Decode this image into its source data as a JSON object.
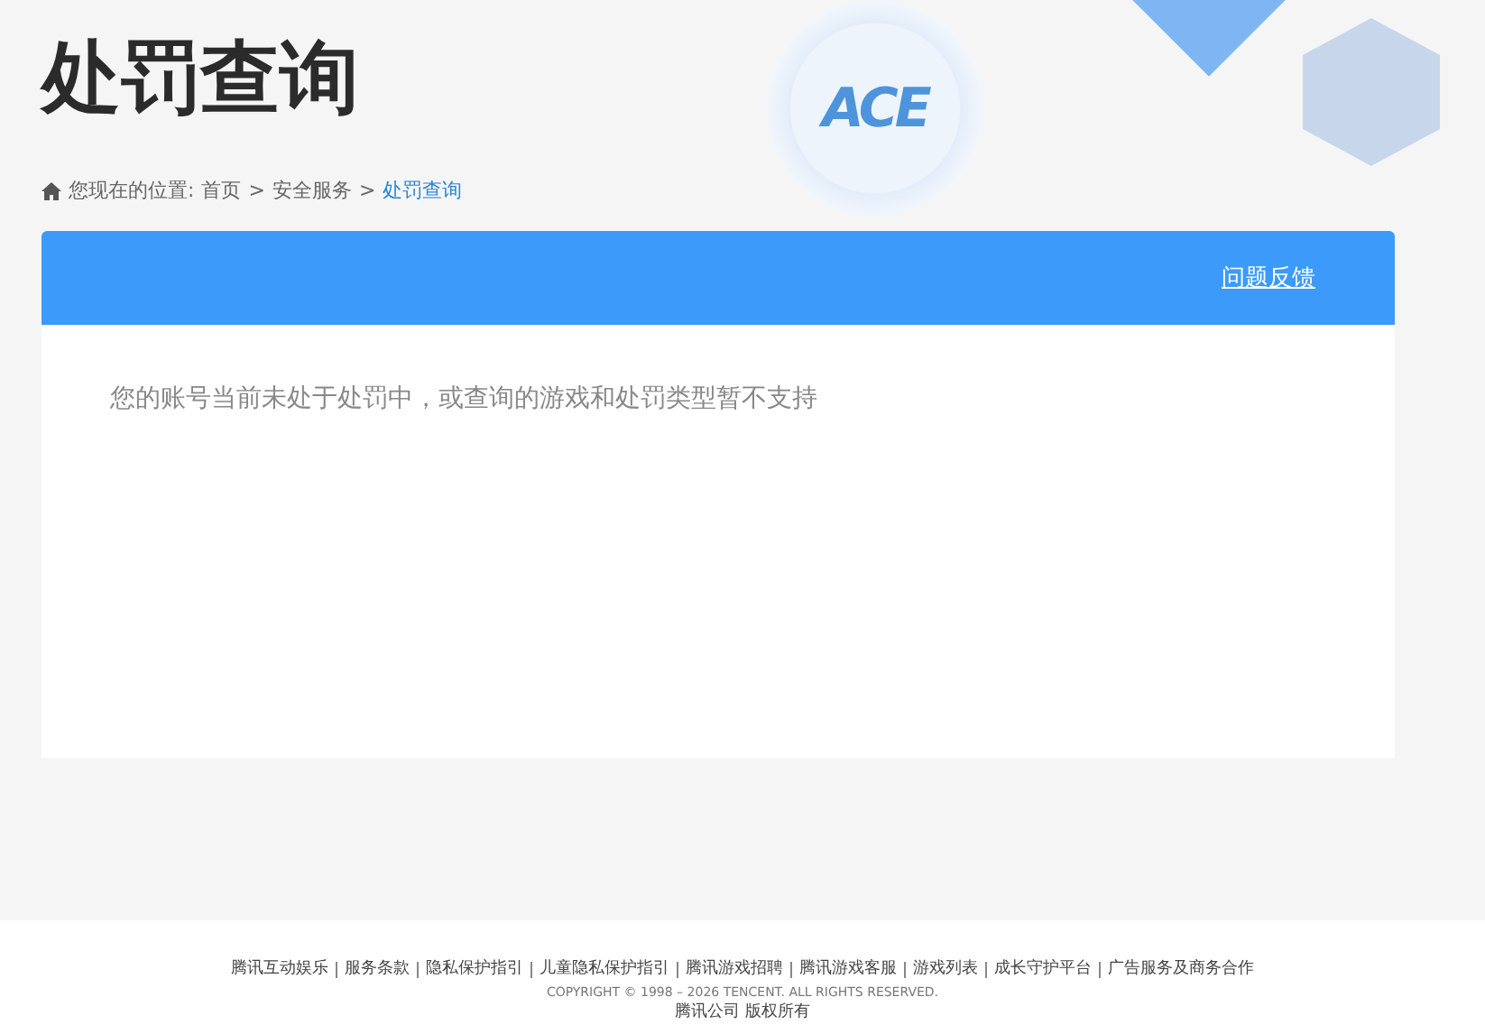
{
  "header": {
    "title": "处罚查询",
    "logo": "ACE"
  },
  "breadcrumb": {
    "prefix": "您现在的位置:",
    "items": [
      {
        "label": "首页",
        "selected": false
      },
      {
        "label": "安全服务",
        "selected": false
      },
      {
        "label": "处罚查询",
        "selected": true
      }
    ],
    "separator": ">"
  },
  "panel": {
    "feedback_link": "问题反馈",
    "message": "您的账号当前未处于处罚中，或查询的游戏和处罚类型暂不支持"
  },
  "footer": {
    "links": [
      "腾讯互动娱乐",
      "服务条款",
      "隐私保护指引",
      "儿童隐私保护指引",
      "腾讯游戏招聘",
      "腾讯游戏客服",
      "游戏列表",
      "成长守护平台",
      "广告服务及商务合作"
    ],
    "copyright": "COPYRIGHT © 1998 – 2026 TENCENT. ALL RIGHTS RESERVED.",
    "company": "腾讯公司 版权所有"
  }
}
